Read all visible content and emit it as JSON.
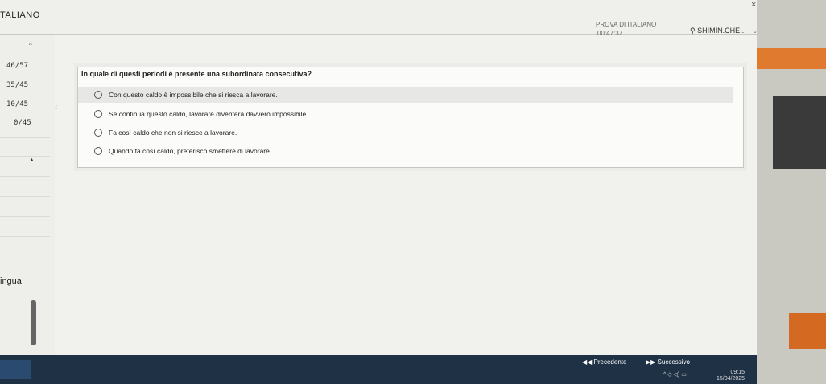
{
  "header": {
    "app_title": "TALIANO",
    "test_name": "PROVA DI ITALIANO",
    "timer": "00:47:37",
    "user": "SHIMIN.CHE...",
    "close": "×"
  },
  "sidebar": {
    "up_arrow": "^",
    "scores": [
      "46/57",
      "35/45",
      "10/45",
      "0/45"
    ],
    "mark": "▲",
    "language_label": "ingua"
  },
  "question": {
    "text": "In quale di questi periodi è presente una subordinata consecutiva?",
    "options": [
      "Con questo caldo è impossibile che si riesca a lavorare.",
      "Se continua questo caldo, lavorare diventerà davvero impossibile.",
      "Fa così caldo che non si riesce a lavorare.",
      "Quando fa così caldo, preferisco smettere di lavorare."
    ]
  },
  "footer": {
    "prev_label": "◀◀  Precedente",
    "next_label": "▶▶  Successivo"
  },
  "taskbar": {
    "time": "09:15",
    "date": "15/04/2025",
    "tray_icons": "^  ◇  ◁)  ▭"
  },
  "colors": {
    "footer_bg": "#1f3145",
    "accent": "#2a4a70"
  }
}
